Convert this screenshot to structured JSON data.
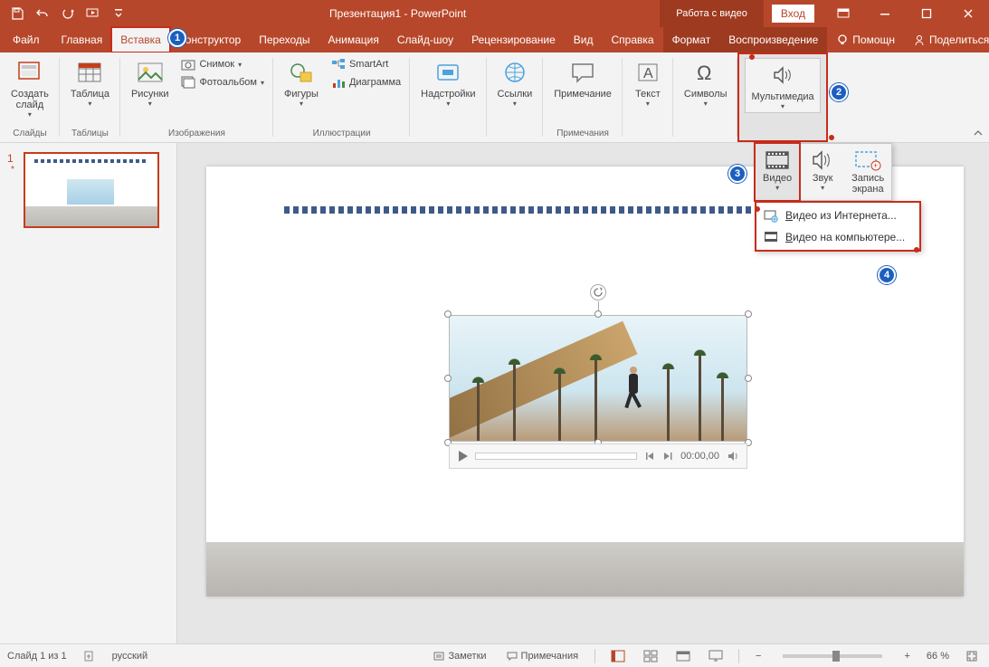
{
  "titlebar": {
    "title": "Презентация1 - PowerPoint",
    "video_tools": "Работа с видео",
    "signin": "Вход"
  },
  "tabs": {
    "file": "Файл",
    "home": "Главная",
    "insert": "Вставка",
    "design": "Конструктор",
    "transitions": "Переходы",
    "animation": "Анимация",
    "slideshow": "Слайд-шоу",
    "review": "Рецензирование",
    "view": "Вид",
    "help": "Справка",
    "format": "Формат",
    "playback": "Воспроизведение",
    "tell_me": "Помощн",
    "share": "Поделиться"
  },
  "ribbon": {
    "slides": {
      "label": "Слайды",
      "new_slide": "Создать\nслайд"
    },
    "tables": {
      "label": "Таблицы",
      "table": "Таблица"
    },
    "images": {
      "label": "Изображения",
      "pictures": "Рисунки",
      "screenshot": "Снимок",
      "album": "Фотоальбом"
    },
    "illustr": {
      "label": "Иллюстрации",
      "shapes": "Фигуры",
      "smartart": "SmartArt",
      "chart": "Диаграмма"
    },
    "addins": {
      "label": "",
      "addins": "Надстройки"
    },
    "links": {
      "label": "",
      "links": "Ссылки"
    },
    "comments": {
      "label": "Примечания",
      "comment": "Примечание"
    },
    "text": {
      "label": "",
      "text": "Текст"
    },
    "symbols": {
      "label": "",
      "symbols": "Символы"
    },
    "media": {
      "label": "",
      "media": "Мультимедиа"
    }
  },
  "media_panel": {
    "video": "Видео",
    "audio": "Звук",
    "screenrec": "Запись\nэкрана",
    "online": "Видео из Интернета...",
    "file": "Видео на компьютере..."
  },
  "callouts": {
    "c1": "1",
    "c2": "2",
    "c3": "3",
    "c4": "4"
  },
  "thumb": {
    "num": "1",
    "star": "*"
  },
  "player": {
    "time": "00:00,00"
  },
  "status": {
    "slide": "Слайд 1 из 1",
    "lang": "русский",
    "notes": "Заметки",
    "comments": "Примечания",
    "zoom": "66 %"
  }
}
